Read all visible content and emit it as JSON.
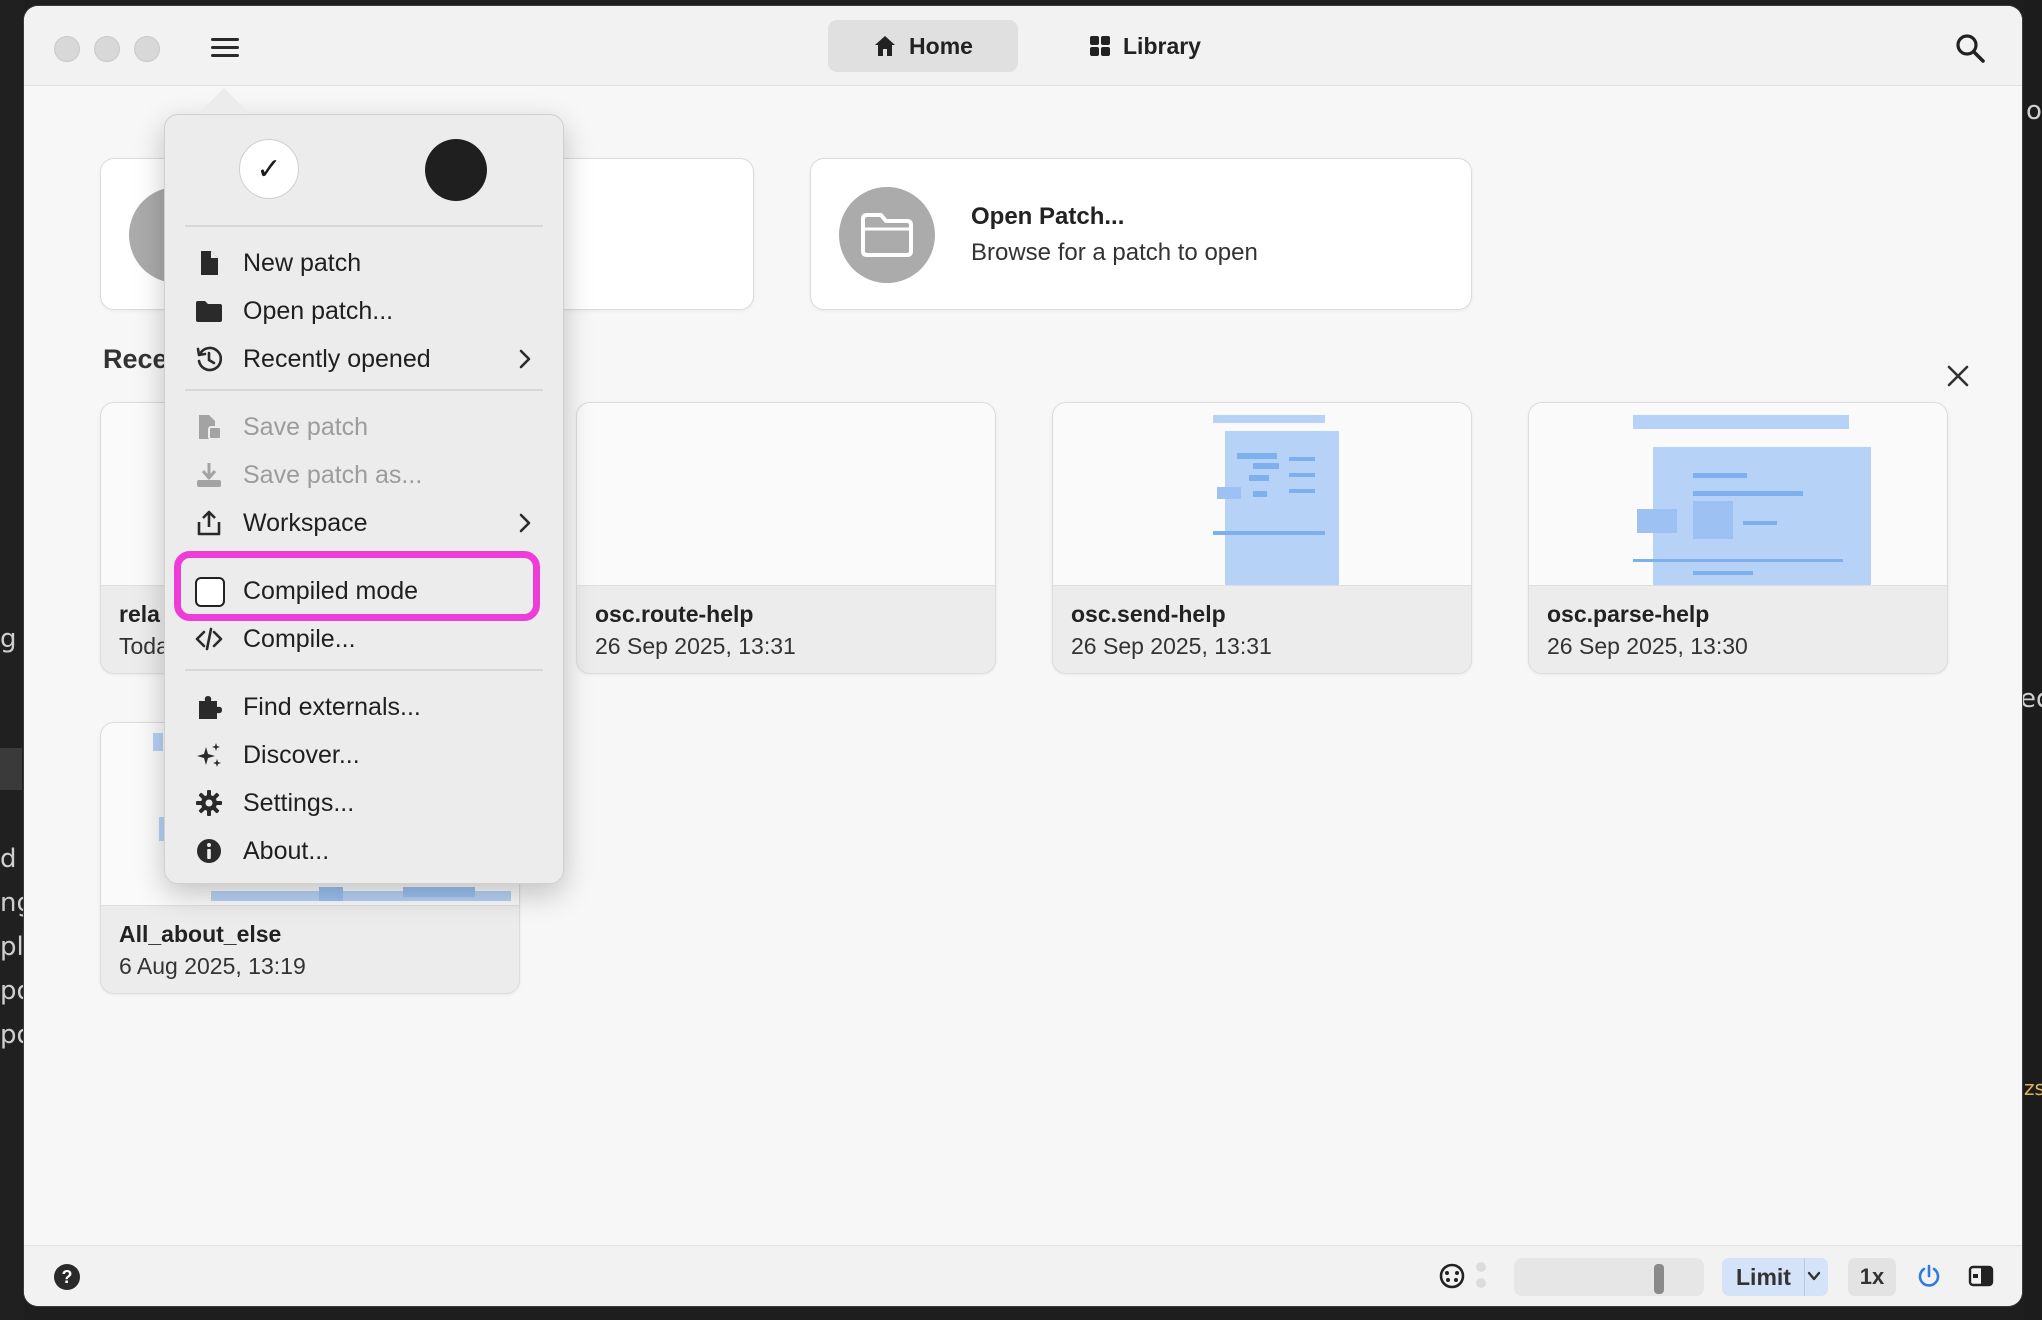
{
  "header": {
    "tabs": [
      {
        "label": "Home",
        "icon": "home-icon",
        "active": true
      },
      {
        "label": "Library",
        "icon": "grid-icon",
        "active": false
      }
    ]
  },
  "actions": {
    "open_patch": {
      "title": "Open Patch...",
      "subtitle": "Browse for a patch to open"
    }
  },
  "recent": {
    "label": "Rece",
    "patches": [
      {
        "name": "rela",
        "date": "Toda"
      },
      {
        "name": "osc.route-help",
        "date": "26 Sep 2025, 13:31"
      },
      {
        "name": "osc.send-help",
        "date": "26 Sep 2025, 13:31"
      },
      {
        "name": "osc.parse-help",
        "date": "26 Sep 2025, 13:30"
      },
      {
        "name": "All_about_else",
        "date": "6 Aug 2025, 13:19"
      }
    ]
  },
  "menu": {
    "theme_light_check": "✓",
    "items": [
      {
        "label": "New patch",
        "icon": "file-icon",
        "enabled": true
      },
      {
        "label": "Open patch...",
        "icon": "folder-icon",
        "enabled": true
      },
      {
        "label": "Recently opened",
        "icon": "history-icon",
        "enabled": true,
        "submenu": true
      },
      {
        "label": "Save patch",
        "icon": "save-icon",
        "enabled": false
      },
      {
        "label": "Save patch as...",
        "icon": "download-icon",
        "enabled": false
      },
      {
        "label": "Workspace",
        "icon": "share-icon",
        "enabled": true,
        "submenu": true
      },
      {
        "label": "Compiled mode",
        "icon": "checkbox-icon",
        "enabled": true,
        "checked": false
      },
      {
        "label": "Compile...",
        "icon": "code-icon",
        "enabled": true
      },
      {
        "label": "Find externals...",
        "icon": "puzzle-icon",
        "enabled": true
      },
      {
        "label": "Discover...",
        "icon": "sparkle-icon",
        "enabled": true
      },
      {
        "label": "Settings...",
        "icon": "gear-icon",
        "enabled": true
      },
      {
        "label": "About...",
        "icon": "info-icon",
        "enabled": true
      }
    ],
    "highlight_color": "#ee3cd9"
  },
  "statusbar": {
    "help": "?",
    "limit_label": "Limit",
    "speed_label": "1x",
    "accent": "#2f7ae5"
  },
  "background_fragments": [
    "g",
    "d",
    "ng",
    "ple",
    "po",
    "po",
    "o",
    "eq",
    "zs"
  ]
}
